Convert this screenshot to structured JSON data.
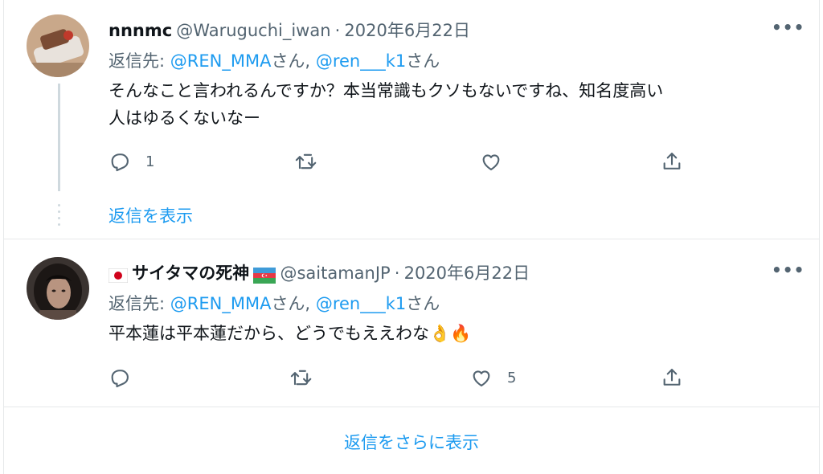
{
  "tweets": [
    {
      "display_name": "nnnmc",
      "handle": "@Waruguchi_iwan",
      "separator": "·",
      "date": "2020年6月22日",
      "reply_prefix": "返信先:",
      "mention1": "@REN_MMA",
      "honorific1": "さん,",
      "mention2": "@ren___k1",
      "honorific2": "さん",
      "text_line1": "そんなこと言われるんですか？本当常識もクソもないですね、知名度高い",
      "text_line2": "人はゆるくないなー",
      "reply_count": "1",
      "like_count": "",
      "show_replies": "返信を表示"
    },
    {
      "display_name": "サイタマの死神",
      "handle": "@saitamanJP",
      "separator": "·",
      "date": "2020年6月22日",
      "reply_prefix": "返信先:",
      "mention1": "@REN_MMA",
      "honorific1": "さん,",
      "mention2": "@ren___k1",
      "honorific2": "さん",
      "text_line1": "平本蓮は平本蓮だから、どうでもええわな",
      "emoji": "👌🔥",
      "reply_count": "",
      "like_count": "5"
    }
  ],
  "show_more_replies": "返信をさらに表示",
  "colors": {
    "accent": "#1d9bf0",
    "muted": "#536471",
    "text": "#0f1419",
    "border": "#e7e9ea"
  },
  "icons": [
    "more-icon",
    "reply-icon",
    "retweet-icon",
    "like-icon",
    "share-icon",
    "japan-flag-icon",
    "azerbaijan-flag-icon"
  ]
}
